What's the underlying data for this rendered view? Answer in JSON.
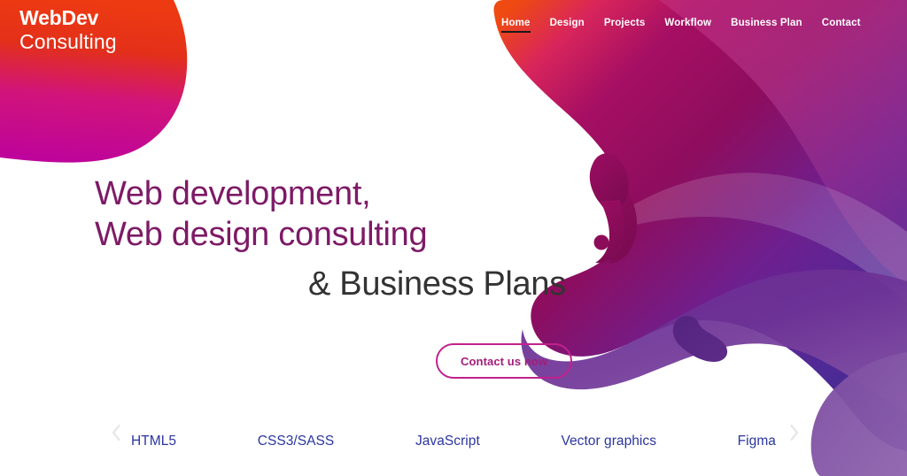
{
  "brand": {
    "line1": "WebDev",
    "line2": "Consulting",
    "gradient_from": "#e8340c",
    "gradient_to": "#c0049b"
  },
  "nav": {
    "items": [
      {
        "label": "Home",
        "active": true
      },
      {
        "label": "Design",
        "active": false
      },
      {
        "label": "Projects",
        "active": false
      },
      {
        "label": "Workflow",
        "active": false
      },
      {
        "label": "Business Plan",
        "active": false
      },
      {
        "label": "Contact",
        "active": false
      }
    ]
  },
  "hero": {
    "line1": "Web development,",
    "line2": "Web design consulting",
    "line3": "& Business Plans",
    "accent_color": "#7d1a66",
    "secondary_color": "#333333"
  },
  "cta": {
    "label": "Contact us now",
    "border_color": "#c2218c",
    "text_color": "#a31d7a"
  },
  "carousel": {
    "prev_icon": "chevron-left-icon",
    "next_icon": "chevron-right-icon",
    "item_color": "#2b35a0",
    "items": [
      {
        "label": "HTML5"
      },
      {
        "label": "CSS3/SASS"
      },
      {
        "label": "JavaScript"
      },
      {
        "label": "Vector graphics"
      },
      {
        "label": "Figma"
      }
    ]
  },
  "artwork": {
    "name": "abstract-fluid-blob",
    "colors": {
      "orange": "#e8400e",
      "crimson": "#c4105a",
      "magenta": "#a80f66",
      "berry": "#8c0d5c",
      "pink": "#b8368c",
      "violet": "#6e2a92",
      "indigo": "#4a2a8c",
      "deep_purple": "#5a2d8c",
      "light_purple": "#8a5aa8"
    }
  }
}
